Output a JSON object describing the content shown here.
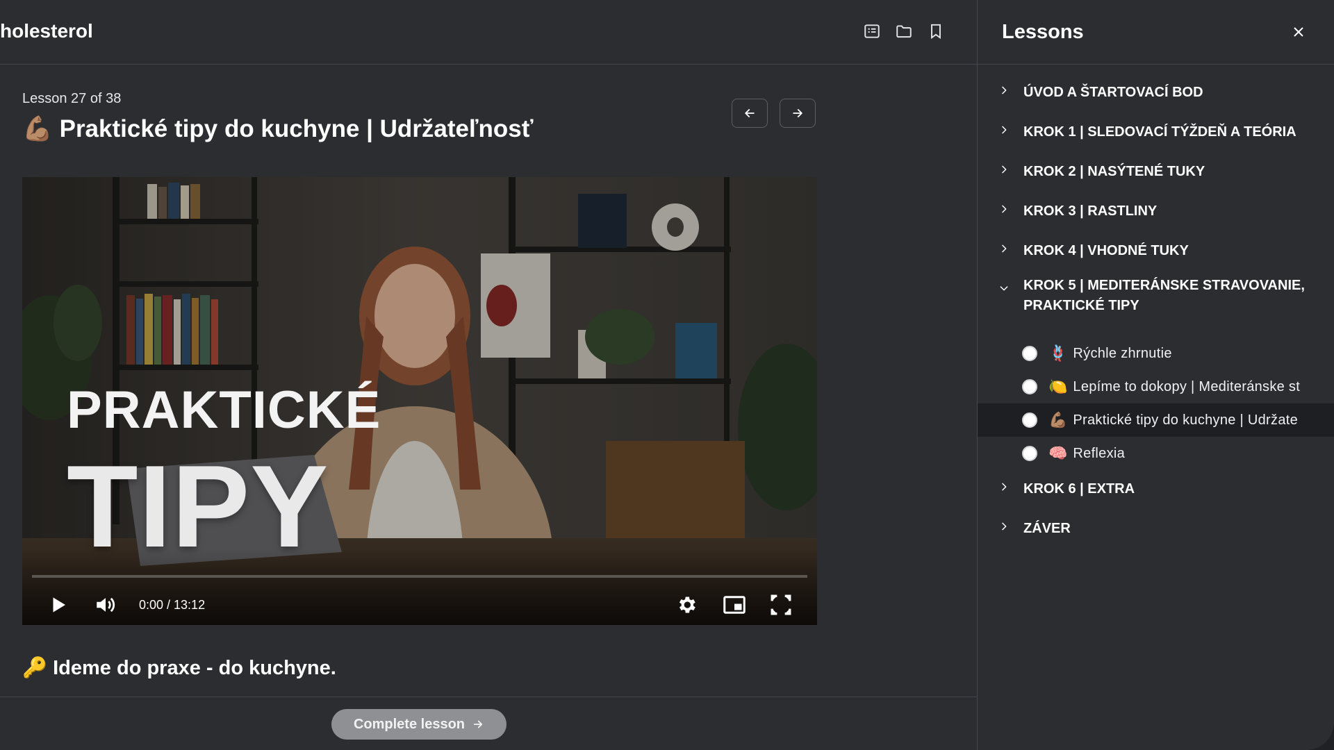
{
  "course": {
    "title": "holesterol"
  },
  "toolbar": {
    "icons": [
      "notes-icon",
      "folder-icon",
      "bookmark-icon"
    ]
  },
  "lesson": {
    "counter": "Lesson 27 of 38",
    "emoji": "💪🏽",
    "title": "Praktické tipy do kuchyne | Udržateľnosť",
    "prev_icon": "arrow-left-icon",
    "next_icon": "arrow-right-icon"
  },
  "video": {
    "overlay_line1": "PRAKTICKÉ",
    "overlay_line2": "TIPY",
    "time": "0:00 / 13:12",
    "progress_fraction": 0
  },
  "description": {
    "emoji": "🔑",
    "text": "Ideme do praxe - do kuchyne."
  },
  "footer": {
    "complete_label": "Complete lesson"
  },
  "sidebar": {
    "title": "Lessons",
    "sections": [
      {
        "label": "ÚVOD A ŠTARTOVACÍ BOD",
        "open": false
      },
      {
        "label": "KROK 1 | SLEDOVACÍ TÝŽDEŇ A TEÓRIA",
        "open": false
      },
      {
        "label": "KROK 2 | NASÝTENÉ TUKY",
        "open": false
      },
      {
        "label": "KROK 3 | RASTLINY",
        "open": false
      },
      {
        "label": "KROK 4 | VHODNÉ TUKY",
        "open": false
      },
      {
        "label": "KROK 5 | MEDITERÁNSKE STRAVOVANIE, PRAKTICKÉ TIPY",
        "open": true,
        "lessons": [
          {
            "emoji": "🪢",
            "label": "Rýchle zhrnutie",
            "active": false
          },
          {
            "emoji": "🍋",
            "label": "Lepíme to dokopy | Mediteránske st",
            "active": false
          },
          {
            "emoji": "💪🏽",
            "label": "Praktické tipy do kuchyne | Udržate",
            "active": true
          },
          {
            "emoji": "🧠",
            "label": "Reflexia",
            "active": false
          }
        ]
      },
      {
        "label": "KROK 6 | EXTRA",
        "open": false
      },
      {
        "label": "ZÁVER",
        "open": false
      }
    ]
  }
}
